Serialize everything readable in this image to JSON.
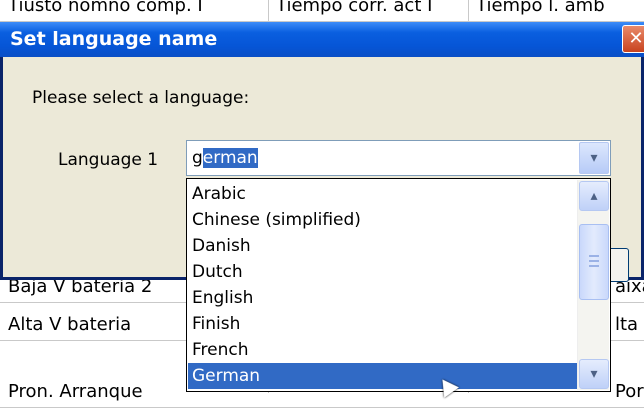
{
  "background_table": {
    "header_row": [
      "Tiusto nomno comp. I",
      "Tiempo corr. act I",
      "Tiempo l. amb"
    ],
    "rows": [
      [
        "Baja V bateria 2",
        "",
        "aixa"
      ],
      [
        "Alta V bateria",
        "",
        "lta"
      ],
      [
        "Pron. Arranque",
        "",
        "Pord"
      ]
    ]
  },
  "dialog": {
    "title": "Set language name",
    "close_glyph": "✕",
    "prompt": "Please select a language:",
    "field_label": "Language 1",
    "combo": {
      "typed_prefix": "g",
      "autocomplete_selected": "erman",
      "dropdown_glyph": "▾"
    },
    "dropdown": {
      "items": [
        "Arabic",
        "Chinese (simplified)",
        "Danish",
        "Dutch",
        "English",
        "Finish",
        "French",
        "German"
      ],
      "selected": "German",
      "scroll_up_glyph": "▴",
      "scroll_down_glyph": "▾"
    }
  }
}
